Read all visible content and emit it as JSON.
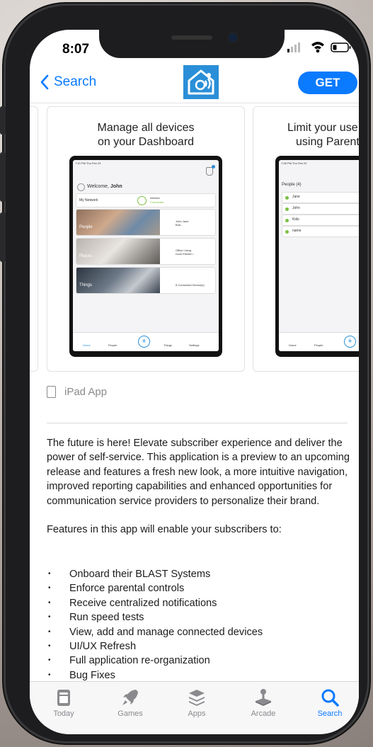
{
  "status_bar": {
    "time": "8:07"
  },
  "nav": {
    "back_label": "Search",
    "get_label": "GET"
  },
  "screenshots": [
    {
      "caption_line1": "Manage all devices",
      "caption_line2": "on your Dashboard",
      "ipad": {
        "status_time": "7:10 PM  Thu Feb 23",
        "welcome": "Welcome,",
        "user": "John",
        "network_label": "My Network",
        "internet_label": "Internet",
        "internet_status": "Connected",
        "tiles": [
          {
            "label": "People",
            "detail": "John Jane Bob..."
          },
          {
            "label": "Places",
            "detail": "Office Living room Kitchen..."
          },
          {
            "label": "Things",
            "detail": "8 Connected Device(s)"
          }
        ],
        "tabs": [
          "Home",
          "People",
          "",
          "Things",
          "Settings"
        ]
      }
    },
    {
      "caption_line1": "Limit your use",
      "caption_line2": "using Parent",
      "ipad": {
        "status_time": "7:08 PM  Thu Feb 23",
        "people_header": "People (4)",
        "people": [
          "Jane",
          "John",
          "Kids",
          "name"
        ],
        "tabs": [
          "Home",
          "People"
        ]
      }
    }
  ],
  "ipad_app_label": "iPad App",
  "description": {
    "paragraph1": "The future is here! Elevate subscriber experience and deliver the power of self-service. This application is a preview to an upcoming release and features a fresh new look, a more intuitive navigation, improved reporting capabilities and enhanced opportunities for communication service providers to personalize their brand.",
    "paragraph2": "Features in this app will enable your subscribers to:",
    "features": [
      "Onboard their BLAST Systems",
      "Enforce parental controls",
      "Receive centralized notifications",
      "Run speed tests",
      "View, add and manage connected devices",
      "UI/UX Refresh",
      "Full application re-organization",
      "Bug Fixes"
    ]
  },
  "tab_bar": {
    "tabs": [
      {
        "label": "Today",
        "icon": "today-icon"
      },
      {
        "label": "Games",
        "icon": "rocket-icon"
      },
      {
        "label": "Apps",
        "icon": "apps-stack-icon"
      },
      {
        "label": "Arcade",
        "icon": "joystick-icon"
      },
      {
        "label": "Search",
        "icon": "search-icon",
        "active": true
      }
    ]
  },
  "colors": {
    "accent": "#0a7aff",
    "app_icon_bg": "#2a8fd8"
  }
}
